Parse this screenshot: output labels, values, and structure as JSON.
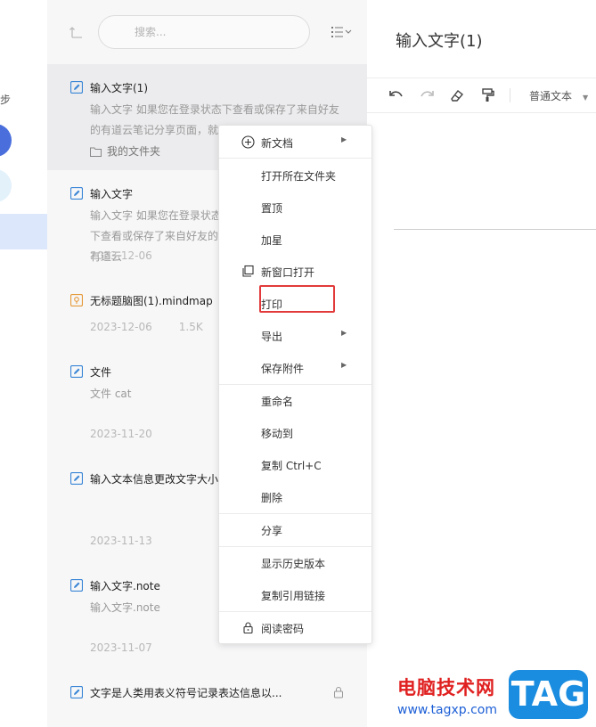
{
  "left_strip": {
    "sync_label": "步"
  },
  "search": {
    "placeholder": "搜索..."
  },
  "notes": [
    {
      "title": "输入文字(1)",
      "snippet": "输入文字 如果您在登录状态下查看或保存了来自好友的有道云笔记分享页面，就",
      "folder": "我的文件夹"
    },
    {
      "title": "输入文字",
      "snippet": "输入文字 如果您在登录状态下查看或保存了来自好友的有道云",
      "date": "2023-12-06"
    },
    {
      "title": "无标题脑图(1).mindmap",
      "date": "2023-12-06",
      "size": "1.5K"
    },
    {
      "title": "文件",
      "snippet": "文件 cat",
      "date": "2023-11-20"
    },
    {
      "title": "输入文本信息更改文字大小",
      "date": "2023-11-13"
    },
    {
      "title": "输入文字.note",
      "snippet": "输入文字.note",
      "date": "2023-11-07"
    },
    {
      "title": "文字是人类用表义符号记录表达信息以..."
    }
  ],
  "editor": {
    "title": "输入文字(1)",
    "style_select": "普通文本"
  },
  "context_menu": {
    "new_doc": "新文档",
    "open_folder": "打开所在文件夹",
    "pin": "置顶",
    "star": "加星",
    "open_new_window": "新窗口打开",
    "print": "打印",
    "export": "导出",
    "save_attachment": "保存附件",
    "rename": "重命名",
    "move_to": "移动到",
    "copy": "复制 Ctrl+C",
    "delete": "删除",
    "share": "分享",
    "history": "显示历史版本",
    "copy_link": "复制引用链接",
    "read_password": "阅读密码"
  },
  "watermark": {
    "site_name": "电脑技术网",
    "url": "www.tagxp.com",
    "tag": "TAG"
  },
  "colors": {
    "accent": "#4a6fdc",
    "highlight": "#e23a3a",
    "selected_bg": "#ececee",
    "panel_bg": "#f7f7f8"
  },
  "icons": [
    "up-level-icon",
    "sort-list-icon",
    "note-icon",
    "mindmap-icon",
    "folder-icon",
    "lock-icon",
    "plus-circle-icon",
    "new-window-icon",
    "undo-icon",
    "redo-icon",
    "eraser-icon",
    "format-painter-icon"
  ]
}
